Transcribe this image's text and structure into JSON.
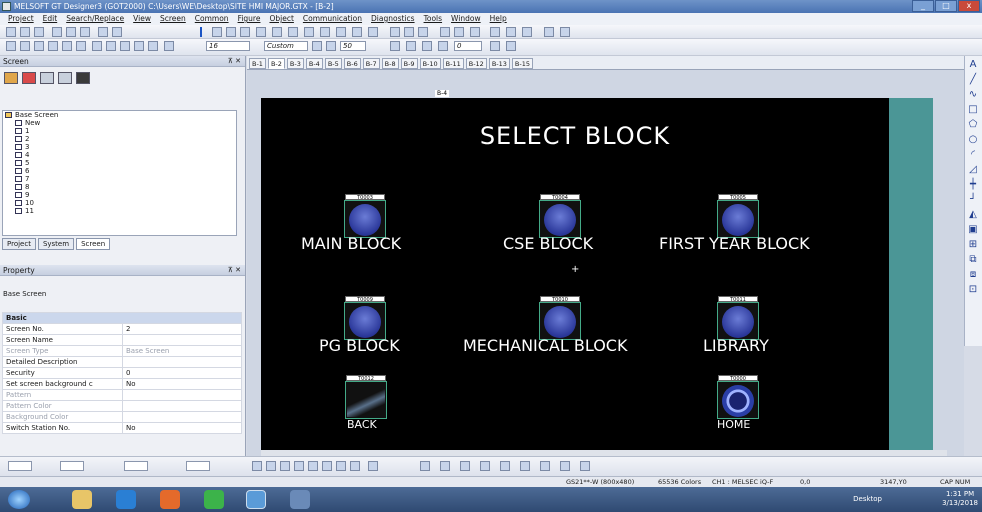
{
  "window": {
    "title": "MELSOFT GT Designer3 (GOT2000) C:\\Users\\WE\\Desktop\\SITE HMI MAJOR.GTX - [B-2]"
  },
  "menubar": [
    "Project",
    "Edit",
    "Search/Replace",
    "View",
    "Screen",
    "Common",
    "Figure",
    "Object",
    "Communication",
    "Diagnostics",
    "Tools",
    "Window",
    "Help"
  ],
  "toolbar": {
    "font_size": "16",
    "zoom": "Custom",
    "zoom_value": "50",
    "grid_value": "0"
  },
  "screen_panel": {
    "title": "Screen",
    "tree_root": "Base Screen",
    "tree_items": [
      "New",
      "1",
      "2",
      "3",
      "4",
      "5",
      "6",
      "7",
      "8",
      "9",
      "10",
      "11"
    ],
    "tabs": [
      "Project",
      "System",
      "Screen"
    ]
  },
  "property_panel": {
    "title": "Property",
    "subtitle": "Base Screen",
    "category": "Basic",
    "rows": [
      {
        "key": "Screen No.",
        "value": "2",
        "grey": false
      },
      {
        "key": "Screen Name",
        "value": "",
        "grey": false
      },
      {
        "key": "Screen Type",
        "value": "Base Screen",
        "grey": true
      },
      {
        "key": "Detailed Description",
        "value": "",
        "grey": false
      },
      {
        "key": "Security",
        "value": "0",
        "grey": false
      },
      {
        "key": "Set screen background c",
        "value": "No",
        "grey": false
      },
      {
        "key": "Pattern",
        "value": "",
        "grey": true
      },
      {
        "key": "Pattern Color",
        "value": "",
        "grey": true
      },
      {
        "key": "Background Color",
        "value": "",
        "grey": true
      },
      {
        "key": "Switch Station No.",
        "value": "No",
        "grey": false
      }
    ]
  },
  "screen_tabs": [
    "B-1",
    "B-2",
    "B-3",
    "B-4",
    "B-5",
    "B-6",
    "B-7",
    "B-8",
    "B-9",
    "B-10",
    "B-11",
    "B-12",
    "B-13",
    "B-15"
  ],
  "active_tab": "B-2",
  "screen_marker": "B-4",
  "hmi_screen": {
    "title": "SELECT BLOCK",
    "buttons": [
      {
        "label": "MAIN BLOCK",
        "tag": "T0003"
      },
      {
        "label": "CSE BLOCK",
        "tag": "T0004"
      },
      {
        "label": "FIRST YEAR BLOCK",
        "tag": "T0005"
      },
      {
        "label": "PG BLOCK",
        "tag": "T0009"
      },
      {
        "label": "MECHANICAL BLOCK",
        "tag": "T0010"
      },
      {
        "label": "LIBRARY",
        "tag": "T0011"
      },
      {
        "label": "BACK",
        "tag": "T0012"
      },
      {
        "label": "HOME",
        "tag": "T0000"
      }
    ],
    "center_mark": "+"
  },
  "status_bar": {
    "model": "GS21**-W (800x480)",
    "colors": "65536 Colors",
    "channel": "CH1 : MELSEC iQ-F",
    "coord1": "0,0",
    "coord2": "3147,Y0",
    "keys": "CAP NUM"
  },
  "taskbar": {
    "desktop_label": "Desktop",
    "time": "1:31 PM",
    "date": "3/13/2018"
  },
  "colors": {
    "canvas": "#000000",
    "teal_margin": "#4b9696",
    "button_blue": "#2a3799",
    "taskbar": "#2f4a72"
  }
}
